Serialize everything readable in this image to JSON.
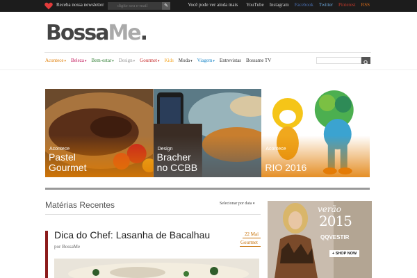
{
  "topbar": {
    "newsletter_label": "Receba nossa newsletter",
    "newsletter_placeholder": "digite seu e-mail",
    "newsletter_button": "✎",
    "social_lead": "Você pode ver ainda mais",
    "social_links": [
      {
        "label": "YouTube",
        "color": "#cccccc"
      },
      {
        "label": "Instagram",
        "color": "#cccccc"
      },
      {
        "label": "Facebook",
        "color": "#4a6fb0"
      },
      {
        "label": "Twitter",
        "color": "#6aa3d6"
      },
      {
        "label": "Pinterest",
        "color": "#c0392b"
      },
      {
        "label": "RSS",
        "color": "#d46a1a"
      }
    ]
  },
  "logo": {
    "part1": "Bossa",
    "part2": "Me",
    "part3": "."
  },
  "nav": {
    "items": [
      {
        "label": "Acontece",
        "caret": true,
        "color": "#e07b00"
      },
      {
        "label": "Beleza",
        "caret": true,
        "color": "#c2185b"
      },
      {
        "label": "Bem-estar",
        "caret": true,
        "color": "#2e7d32"
      },
      {
        "label": "Design",
        "caret": true,
        "color": "#999999"
      },
      {
        "label": "Gourmet",
        "caret": true,
        "color": "#c62828"
      },
      {
        "label": "Kids",
        "caret": false,
        "color": "#f5a623"
      },
      {
        "label": "Moda",
        "caret": true,
        "color": "#333333"
      },
      {
        "label": "Viagem",
        "caret": true,
        "color": "#1e88c9"
      },
      {
        "label": "Entrevistas",
        "caret": false,
        "color": "#333333"
      },
      {
        "label": "Bossame TV",
        "caret": false,
        "color": "#333333"
      }
    ]
  },
  "slides": [
    {
      "category": "Acontece",
      "title": "Pastel\nGourmet",
      "accent": "#e07b00"
    },
    {
      "category": "Design",
      "title": "Bracher\nno CCBB",
      "accent": "#777777"
    },
    {
      "category": "Acontece",
      "title": "RIO 2016",
      "accent": "#e07b00"
    }
  ],
  "recent": {
    "title": "Matérias Recentes",
    "sort_label": "Selecionar por data",
    "post": {
      "title": "Dica do Chef: Lasanha de Bacalhau",
      "author": "por BossaMe",
      "date": "22 Mai",
      "category": "Gourmet"
    }
  },
  "ad": {
    "season": "verão",
    "year": "2015",
    "brand": "QQVESTIR",
    "cta": "+ SHOP NOW"
  }
}
